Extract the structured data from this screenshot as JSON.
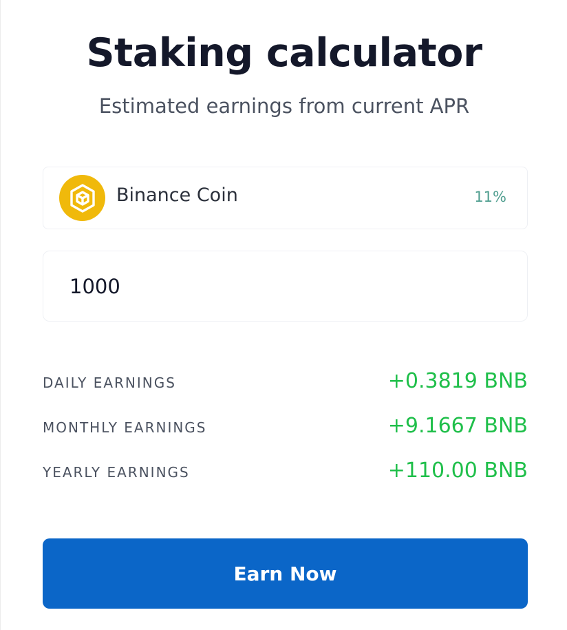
{
  "header": {
    "title": "Staking calculator",
    "subtitle": "Estimated earnings from current APR"
  },
  "coin_selector": {
    "name": "Binance Coin",
    "apr": "11%",
    "icon": "bnb-logo-icon",
    "brand_color": "#f0b90b"
  },
  "amount_input": {
    "value": "1000"
  },
  "earnings": [
    {
      "label": "DAILY EARNINGS",
      "value": "+0.3819 BNB"
    },
    {
      "label": "MONTHLY EARNINGS",
      "value": "+9.1667 BNB"
    },
    {
      "label": "YEARLY EARNINGS",
      "value": "+110.00 BNB"
    }
  ],
  "cta": {
    "label": "Earn Now",
    "color": "#0b66c8"
  },
  "colors": {
    "positive": "#1fbf4a",
    "apr": "#4f9e8f"
  }
}
